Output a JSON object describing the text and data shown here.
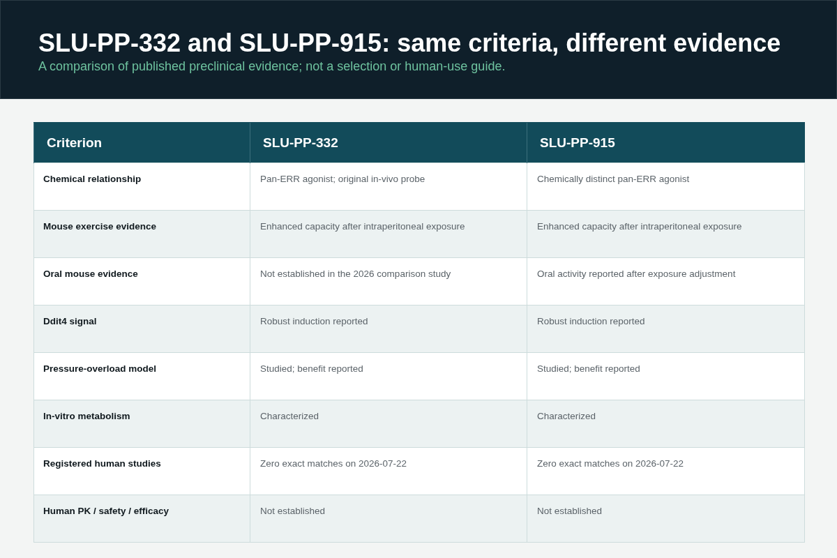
{
  "header": {
    "title": "SLU-PP-332 and SLU-PP-915: same criteria, different evidence",
    "subtitle": "A comparison of published preclinical evidence; not a selection or human-use guide."
  },
  "table": {
    "columns": [
      "Criterion",
      "SLU-PP-332",
      "SLU-PP-915"
    ],
    "rows": [
      {
        "criterion": "Chemical relationship",
        "values": [
          "Pan-ERR agonist; original in-vivo probe",
          "Chemically distinct pan-ERR agonist"
        ]
      },
      {
        "criterion": "Mouse exercise evidence",
        "values": [
          "Enhanced capacity after intraperitoneal exposure",
          "Enhanced capacity after intraperitoneal exposure"
        ]
      },
      {
        "criterion": "Oral mouse evidence",
        "values": [
          "Not established in the 2026 comparison study",
          "Oral activity reported after exposure adjustment"
        ]
      },
      {
        "criterion": "Ddit4 signal",
        "values": [
          "Robust induction reported",
          "Robust induction reported"
        ]
      },
      {
        "criterion": "Pressure-overload model",
        "values": [
          "Studied; benefit reported",
          "Studied; benefit reported"
        ]
      },
      {
        "criterion": "In-vitro metabolism",
        "values": [
          "Characterized",
          "Characterized"
        ]
      },
      {
        "criterion": "Registered human studies",
        "values": [
          "Zero exact matches on 2026-07-22",
          "Zero exact matches on 2026-07-22"
        ]
      },
      {
        "criterion": "Human PK / safety / efficacy",
        "values": [
          "Not established",
          "Not established"
        ]
      }
    ]
  }
}
